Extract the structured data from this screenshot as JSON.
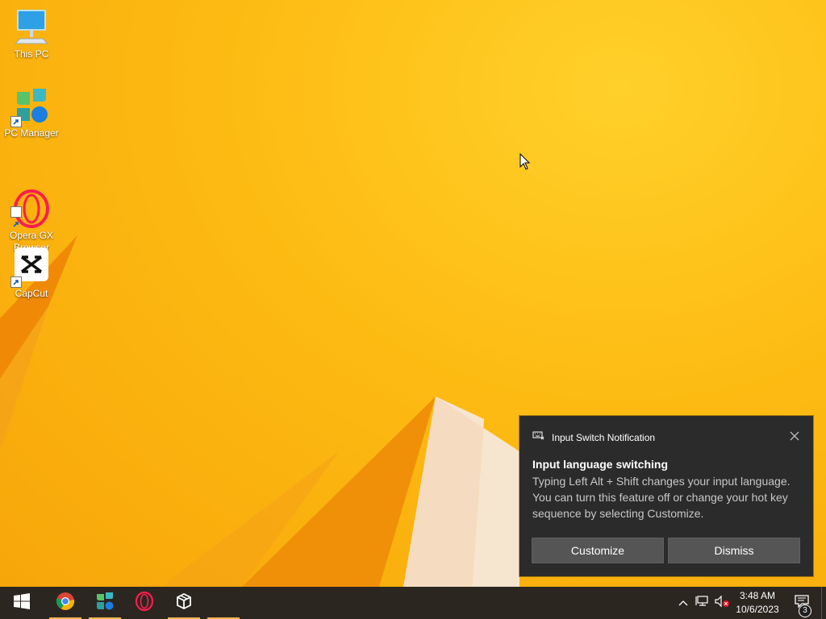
{
  "desktop": {
    "icons": [
      {
        "label": "This PC",
        "icon": "this-pc-icon"
      },
      {
        "label": "PC Manager",
        "icon": "pc-manager-icon"
      },
      {
        "label": "Opera GX\nBrowser",
        "icon": "opera-gx-icon"
      },
      {
        "label": "CapCut",
        "icon": "capcut-icon"
      }
    ]
  },
  "toast": {
    "app_name": "Input Switch Notification",
    "title": "Input language switching",
    "body": "Typing Left Alt + Shift changes your input language. You can turn this feature off or change your hot key sequence by selecting Customize.",
    "customize_label": "Customize",
    "dismiss_label": "Dismiss"
  },
  "taskbar": {
    "apps": [
      {
        "name": "start",
        "icon": "windows-logo-icon"
      },
      {
        "name": "chrome",
        "icon": "chrome-icon"
      },
      {
        "name": "pc-manager",
        "icon": "pc-manager-icon"
      },
      {
        "name": "opera",
        "icon": "opera-icon"
      },
      {
        "name": "box-app",
        "icon": "package-icon"
      }
    ],
    "clock": {
      "time": "3:48 AM",
      "date": "10/6/2023"
    },
    "notification_count": "3"
  },
  "colors": {
    "wallpaper": "#fdbb12",
    "taskbar": "#2c2621",
    "toast_bg": "#2b2b2b",
    "toast_button": "#555555",
    "taskbar_highlight": "#f2b64c"
  }
}
